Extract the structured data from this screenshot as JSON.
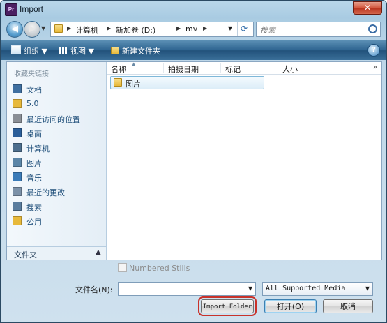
{
  "window": {
    "app_icon": "Pr",
    "title": "Import",
    "close_glyph": "✕"
  },
  "address_bar": {
    "back_glyph": "◀",
    "forward_glyph": "▶",
    "crumbs": [
      "计算机",
      "新加卷 (D:)",
      "mv"
    ],
    "search_placeholder": "搜索"
  },
  "toolbar": {
    "organize": "组织 ▼",
    "views": "视图 ▼",
    "new_folder": "新建文件夹",
    "help": "?"
  },
  "sidebar": {
    "heading": "收藏夹链接",
    "items": [
      {
        "label": "文档",
        "icon": "documents-icon",
        "color": "#3f6fa0"
      },
      {
        "label": "5.0",
        "icon": "folder-icon",
        "color": "#e7b93b"
      },
      {
        "label": "最近访问的位置",
        "icon": "recent-places-icon",
        "color": "#8a8f96"
      },
      {
        "label": "桌面",
        "icon": "desktop-icon",
        "color": "#2b5f9a"
      },
      {
        "label": "计算机",
        "icon": "computer-icon",
        "color": "#4d6f8e"
      },
      {
        "label": "图片",
        "icon": "pictures-icon",
        "color": "#5b86a8"
      },
      {
        "label": "音乐",
        "icon": "music-icon",
        "color": "#3a7bb8"
      },
      {
        "label": "最近的更改",
        "icon": "recent-changes-icon",
        "color": "#7b91a8"
      },
      {
        "label": "搜索",
        "icon": "search-folder-icon",
        "color": "#5a7d9e"
      },
      {
        "label": "公用",
        "icon": "public-folder-icon",
        "color": "#e7b93b"
      }
    ],
    "footer": "文件夹"
  },
  "file_list": {
    "columns": [
      "名称",
      "拍摄日期",
      "标记",
      "大小"
    ],
    "more_glyph": "»",
    "items": [
      {
        "name": "图片",
        "icon": "folder-icon"
      }
    ]
  },
  "options": {
    "numbered_stills": "Numbered Stills"
  },
  "filename": {
    "label": "文件名(N):",
    "value": ""
  },
  "filetype": {
    "selected": "All Supported Media"
  },
  "buttons": {
    "import_folder": "Import Folder",
    "open": "打开(O)",
    "cancel": "取消"
  }
}
